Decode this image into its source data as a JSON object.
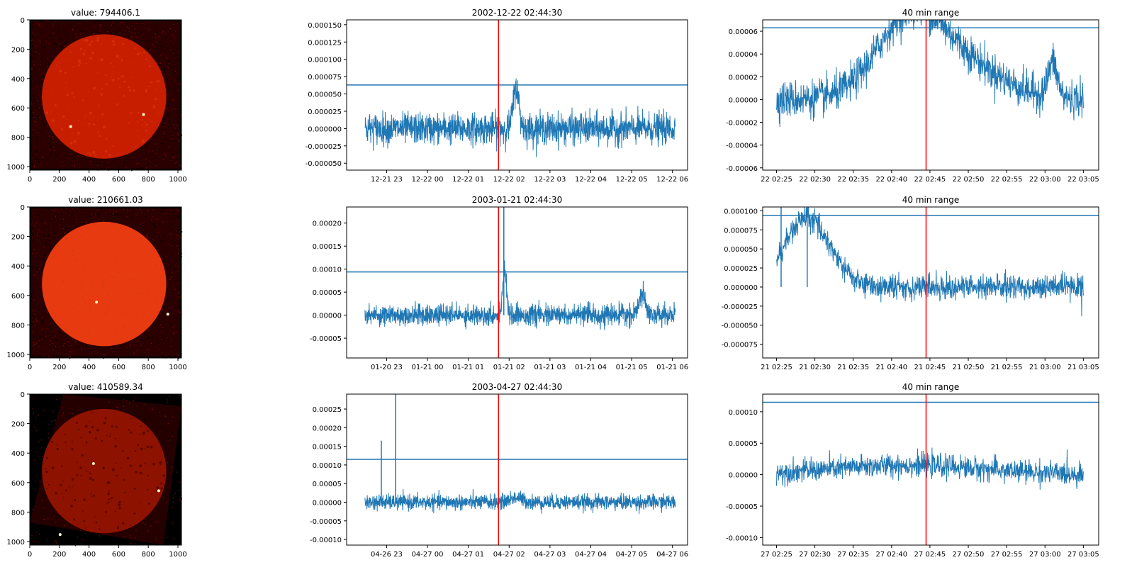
{
  "colors": {
    "series": "#1f77b4",
    "marker_line": "#ff0000",
    "solar_background": "#2a0000",
    "solar_disk": "#c81e00"
  },
  "rows": [
    {
      "image": {
        "title": "value: 794406.1",
        "xticks": [
          "0",
          "200",
          "400",
          "600",
          "800",
          "1000"
        ],
        "yticks": [
          "0",
          "200",
          "400",
          "600",
          "800",
          "1000"
        ],
        "variant": "disk"
      },
      "day": {
        "title": "2002-12-22 02:44:30",
        "type": "line",
        "xticks": [
          "12-21 23",
          "12-22 00",
          "12-22 01",
          "12-22 02",
          "12-22 03",
          "12-22 04",
          "12-22 05",
          "12-22 06"
        ],
        "yticks": [
          "0.000150",
          "0.000125",
          "0.000100",
          "0.000075",
          "0.000050",
          "0.000025",
          "0.000000",
          "-0.000025",
          "-0.000050"
        ],
        "ylim": [
          -6e-05,
          0.000157
        ],
        "threshold": 6.3e-05,
        "marker_hours": 3.74,
        "noise": 1.1e-05,
        "events": [
          {
            "center": 3.7,
            "width": 0.07,
            "amp": 6e-05
          }
        ]
      },
      "zoom": {
        "title": "40 min range",
        "type": "line",
        "xticks": [
          "22 02:25",
          "22 02:30",
          "22 02:35",
          "22 02:40",
          "22 02:45",
          "22 02:50",
          "22 02:55",
          "22 03:00",
          "22 03:05"
        ],
        "yticks": [
          "0.00006",
          "0.00004",
          "0.00002",
          "0.00000",
          "-0.00002",
          "-0.00004",
          "-0.00006"
        ],
        "ylim": [
          -6.2e-05,
          7e-05
        ],
        "threshold": 6.3e-05,
        "marker_min": 19.5,
        "noise": 8e-06,
        "events": [
          {
            "center": 17.0,
            "width": 4.0,
            "amp": 5e-05
          },
          {
            "center": 22.0,
            "width": 6.0,
            "amp": 4e-05
          },
          {
            "center": 36.0,
            "width": 0.6,
            "amp": 3e-05
          }
        ]
      }
    },
    {
      "image": {
        "title": "value: 210661.03",
        "xticks": [
          "0",
          "200",
          "400",
          "600",
          "800",
          "1000"
        ],
        "yticks": [
          "0",
          "200",
          "400",
          "600",
          "800",
          "1000"
        ],
        "variant": "bright"
      },
      "day": {
        "title": "2003-01-21 02:44:30",
        "type": "line",
        "xticks": [
          "01-20 23",
          "01-21 00",
          "01-21 01",
          "01-21 02",
          "01-21 03",
          "01-21 04",
          "01-21 05",
          "01-21 06"
        ],
        "yticks": [
          "0.00020",
          "0.00015",
          "0.00010",
          "0.00005",
          "0.00000",
          "-0.00005"
        ],
        "ylim": [
          -9.3e-05,
          0.000235
        ],
        "threshold": 9.4e-05,
        "marker_hours": 3.74,
        "noise": 1.1e-05,
        "events": [
          {
            "center": 3.42,
            "width": 0.05,
            "amp": 0.0001
          },
          {
            "center": 6.8,
            "width": 0.08,
            "amp": 4.5e-05
          }
        ],
        "spikes": [
          {
            "x": 3.4,
            "y": 0.000235
          }
        ]
      },
      "zoom": {
        "title": "40 min range",
        "type": "line",
        "xticks": [
          "21 02:25",
          "21 02:30",
          "21 02:35",
          "21 02:40",
          "21 02:45",
          "21 02:50",
          "21 02:55",
          "21 03:00",
          "21 03:05"
        ],
        "yticks": [
          "0.000100",
          "0.000075",
          "0.000050",
          "0.000025",
          "0.000000",
          "-0.000025",
          "-0.000050",
          "-0.000075"
        ],
        "ylim": [
          -9.3e-05,
          0.000105
        ],
        "threshold": 9.4e-05,
        "marker_min": 19.5,
        "noise": 8e-06,
        "events": [
          {
            "center": 4.0,
            "width": 3.0,
            "amp": 9e-05
          }
        ],
        "spikes": [
          {
            "x": 0.6,
            "y": 0.000105
          },
          {
            "x": 4.0,
            "y": 0.000105
          }
        ]
      }
    },
    {
      "image": {
        "title": "value: 410589.34",
        "xticks": [
          "0",
          "200",
          "400",
          "600",
          "800",
          "1000"
        ],
        "yticks": [
          "0",
          "200",
          "400",
          "600",
          "800",
          "1000"
        ],
        "variant": "rotated"
      },
      "day": {
        "title": "2003-04-27 02:44:30",
        "type": "line",
        "xticks": [
          "04-26 23",
          "04-27 00",
          "04-27 01",
          "04-27 02",
          "04-27 03",
          "04-27 04",
          "04-27 05",
          "04-27 06"
        ],
        "yticks": [
          "0.00025",
          "0.00020",
          "0.00015",
          "0.00010",
          "0.00005",
          "0.00000",
          "-0.00005",
          "-0.00010"
        ],
        "ylim": [
          -0.000115,
          0.00029
        ],
        "threshold": 0.000115,
        "marker_hours": 3.74,
        "noise": 1e-05,
        "events": [
          {
            "center": 3.7,
            "width": 0.15,
            "amp": 1.2e-05
          }
        ],
        "spikes": [
          {
            "x": 0.4,
            "y": 0.000165
          },
          {
            "x": 0.75,
            "y": 0.00029
          }
        ]
      },
      "zoom": {
        "title": "40 min range",
        "type": "line",
        "xticks": [
          "27 02:25",
          "27 02:30",
          "27 02:35",
          "27 02:40",
          "27 02:45",
          "27 02:50",
          "27 02:55",
          "27 03:00",
          "27 03:05"
        ],
        "yticks": [
          "0.00010",
          "0.00005",
          "0.00000",
          "-0.00005",
          "-0.00010"
        ],
        "ylim": [
          -0.000112,
          0.000128
        ],
        "threshold": 0.000115,
        "marker_min": 19.5,
        "noise": 9e-06,
        "events": [
          {
            "center": 17.0,
            "width": 10.0,
            "amp": 1.5e-05
          }
        ]
      }
    }
  ]
}
